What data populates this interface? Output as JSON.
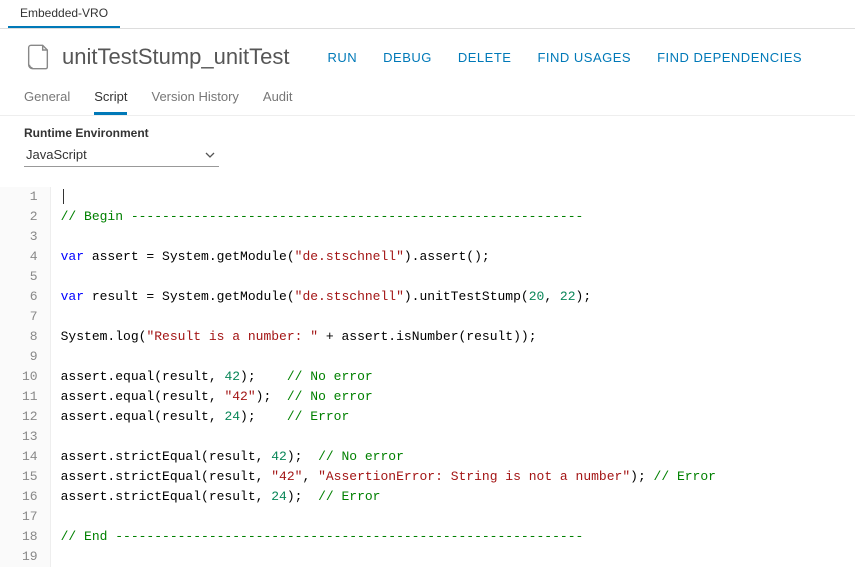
{
  "topTabs": {
    "active": "Embedded-VRO"
  },
  "title": "unitTestStump_unitTest",
  "actions": {
    "run": "RUN",
    "debug": "DEBUG",
    "delete": "DELETE",
    "findUsages": "FIND USAGES",
    "findDependencies": "FIND DEPENDENCIES"
  },
  "subTabs": {
    "general": "General",
    "script": "Script",
    "versionHistory": "Version History",
    "audit": "Audit"
  },
  "runtime": {
    "label": "Runtime Environment",
    "value": "JavaScript"
  },
  "code": {
    "lines": [
      {
        "n": 1,
        "tokens": []
      },
      {
        "n": 2,
        "tokens": [
          {
            "t": "// Begin ----------------------------------------------------------",
            "c": "c-comment"
          }
        ]
      },
      {
        "n": 3,
        "tokens": []
      },
      {
        "n": 4,
        "tokens": [
          {
            "t": "var",
            "c": "c-kw"
          },
          {
            "t": " assert = System.getModule(",
            "c": "c-ident"
          },
          {
            "t": "\"de.stschnell\"",
            "c": "c-string"
          },
          {
            "t": ").assert();",
            "c": "c-ident"
          }
        ]
      },
      {
        "n": 5,
        "tokens": []
      },
      {
        "n": 6,
        "tokens": [
          {
            "t": "var",
            "c": "c-kw"
          },
          {
            "t": " result = System.getModule(",
            "c": "c-ident"
          },
          {
            "t": "\"de.stschnell\"",
            "c": "c-string"
          },
          {
            "t": ").unitTestStump(",
            "c": "c-ident"
          },
          {
            "t": "20",
            "c": "c-num"
          },
          {
            "t": ", ",
            "c": "c-ident"
          },
          {
            "t": "22",
            "c": "c-num"
          },
          {
            "t": ");",
            "c": "c-ident"
          }
        ]
      },
      {
        "n": 7,
        "tokens": []
      },
      {
        "n": 8,
        "tokens": [
          {
            "t": "System.log(",
            "c": "c-ident"
          },
          {
            "t": "\"Result is a number: \"",
            "c": "c-string"
          },
          {
            "t": " + assert.isNumber(result));",
            "c": "c-ident"
          }
        ]
      },
      {
        "n": 9,
        "tokens": []
      },
      {
        "n": 10,
        "tokens": [
          {
            "t": "assert.equal(result, ",
            "c": "c-ident"
          },
          {
            "t": "42",
            "c": "c-num"
          },
          {
            "t": ");    ",
            "c": "c-ident"
          },
          {
            "t": "// No error",
            "c": "c-comment"
          }
        ]
      },
      {
        "n": 11,
        "tokens": [
          {
            "t": "assert.equal(result, ",
            "c": "c-ident"
          },
          {
            "t": "\"42\"",
            "c": "c-string"
          },
          {
            "t": ");  ",
            "c": "c-ident"
          },
          {
            "t": "// No error",
            "c": "c-comment"
          }
        ]
      },
      {
        "n": 12,
        "tokens": [
          {
            "t": "assert.equal(result, ",
            "c": "c-ident"
          },
          {
            "t": "24",
            "c": "c-num"
          },
          {
            "t": ");    ",
            "c": "c-ident"
          },
          {
            "t": "// Error",
            "c": "c-comment"
          }
        ]
      },
      {
        "n": 13,
        "tokens": []
      },
      {
        "n": 14,
        "tokens": [
          {
            "t": "assert.strictEqual(result, ",
            "c": "c-ident"
          },
          {
            "t": "42",
            "c": "c-num"
          },
          {
            "t": ");  ",
            "c": "c-ident"
          },
          {
            "t": "// No error",
            "c": "c-comment"
          }
        ]
      },
      {
        "n": 15,
        "tokens": [
          {
            "t": "assert.strictEqual(result, ",
            "c": "c-ident"
          },
          {
            "t": "\"42\"",
            "c": "c-string"
          },
          {
            "t": ", ",
            "c": "c-ident"
          },
          {
            "t": "\"AssertionError: String is not a number\"",
            "c": "c-string"
          },
          {
            "t": "); ",
            "c": "c-ident"
          },
          {
            "t": "// Error",
            "c": "c-comment"
          }
        ]
      },
      {
        "n": 16,
        "tokens": [
          {
            "t": "assert.strictEqual(result, ",
            "c": "c-ident"
          },
          {
            "t": "24",
            "c": "c-num"
          },
          {
            "t": ");  ",
            "c": "c-ident"
          },
          {
            "t": "// Error",
            "c": "c-comment"
          }
        ]
      },
      {
        "n": 17,
        "tokens": []
      },
      {
        "n": 18,
        "tokens": [
          {
            "t": "// End ------------------------------------------------------------",
            "c": "c-comment"
          }
        ]
      },
      {
        "n": 19,
        "tokens": []
      }
    ]
  }
}
